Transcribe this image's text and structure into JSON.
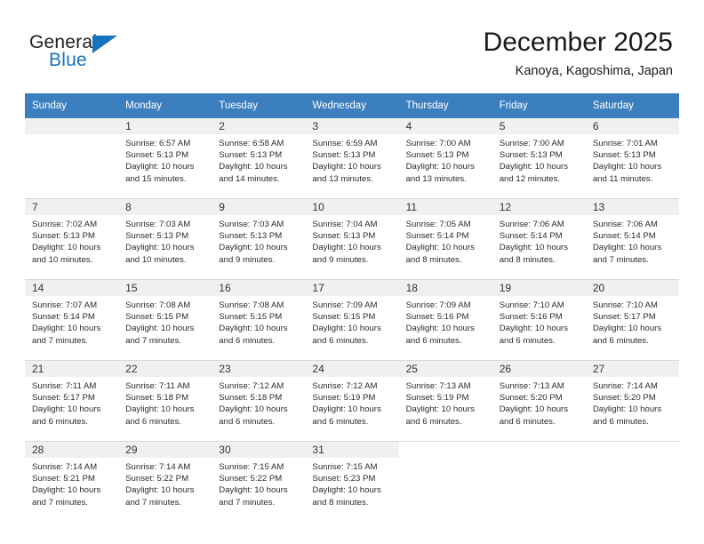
{
  "brand": {
    "name_part1": "General",
    "name_part2": "Blue",
    "accent_color": "#1673bd",
    "triangle_icon": "triangle-icon"
  },
  "header": {
    "title": "December 2025",
    "subtitle": "Kanoya, Kagoshima, Japan"
  },
  "theme": {
    "header_row_bg": "#3c7fbf",
    "daynum_band_bg": "#f0f0f0",
    "grid_line": "#d8d8d8"
  },
  "weekday_headers": [
    "Sunday",
    "Monday",
    "Tuesday",
    "Wednesday",
    "Thursday",
    "Friday",
    "Saturday"
  ],
  "labels": {
    "sunrise_prefix": "Sunrise:",
    "sunset_prefix": "Sunset:",
    "daylight_prefix": "Daylight:"
  },
  "weeks": [
    [
      {
        "day": "",
        "sunrise": "",
        "sunset": "",
        "daylight_line1": "",
        "daylight_line2": ""
      },
      {
        "day": "1",
        "sunrise": "Sunrise: 6:57 AM",
        "sunset": "Sunset: 5:13 PM",
        "daylight_line1": "Daylight: 10 hours",
        "daylight_line2": "and 15 minutes."
      },
      {
        "day": "2",
        "sunrise": "Sunrise: 6:58 AM",
        "sunset": "Sunset: 5:13 PM",
        "daylight_line1": "Daylight: 10 hours",
        "daylight_line2": "and 14 minutes."
      },
      {
        "day": "3",
        "sunrise": "Sunrise: 6:59 AM",
        "sunset": "Sunset: 5:13 PM",
        "daylight_line1": "Daylight: 10 hours",
        "daylight_line2": "and 13 minutes."
      },
      {
        "day": "4",
        "sunrise": "Sunrise: 7:00 AM",
        "sunset": "Sunset: 5:13 PM",
        "daylight_line1": "Daylight: 10 hours",
        "daylight_line2": "and 13 minutes."
      },
      {
        "day": "5",
        "sunrise": "Sunrise: 7:00 AM",
        "sunset": "Sunset: 5:13 PM",
        "daylight_line1": "Daylight: 10 hours",
        "daylight_line2": "and 12 minutes."
      },
      {
        "day": "6",
        "sunrise": "Sunrise: 7:01 AM",
        "sunset": "Sunset: 5:13 PM",
        "daylight_line1": "Daylight: 10 hours",
        "daylight_line2": "and 11 minutes."
      }
    ],
    [
      {
        "day": "7",
        "sunrise": "Sunrise: 7:02 AM",
        "sunset": "Sunset: 5:13 PM",
        "daylight_line1": "Daylight: 10 hours",
        "daylight_line2": "and 10 minutes."
      },
      {
        "day": "8",
        "sunrise": "Sunrise: 7:03 AM",
        "sunset": "Sunset: 5:13 PM",
        "daylight_line1": "Daylight: 10 hours",
        "daylight_line2": "and 10 minutes."
      },
      {
        "day": "9",
        "sunrise": "Sunrise: 7:03 AM",
        "sunset": "Sunset: 5:13 PM",
        "daylight_line1": "Daylight: 10 hours",
        "daylight_line2": "and 9 minutes."
      },
      {
        "day": "10",
        "sunrise": "Sunrise: 7:04 AM",
        "sunset": "Sunset: 5:13 PM",
        "daylight_line1": "Daylight: 10 hours",
        "daylight_line2": "and 9 minutes."
      },
      {
        "day": "11",
        "sunrise": "Sunrise: 7:05 AM",
        "sunset": "Sunset: 5:14 PM",
        "daylight_line1": "Daylight: 10 hours",
        "daylight_line2": "and 8 minutes."
      },
      {
        "day": "12",
        "sunrise": "Sunrise: 7:06 AM",
        "sunset": "Sunset: 5:14 PM",
        "daylight_line1": "Daylight: 10 hours",
        "daylight_line2": "and 8 minutes."
      },
      {
        "day": "13",
        "sunrise": "Sunrise: 7:06 AM",
        "sunset": "Sunset: 5:14 PM",
        "daylight_line1": "Daylight: 10 hours",
        "daylight_line2": "and 7 minutes."
      }
    ],
    [
      {
        "day": "14",
        "sunrise": "Sunrise: 7:07 AM",
        "sunset": "Sunset: 5:14 PM",
        "daylight_line1": "Daylight: 10 hours",
        "daylight_line2": "and 7 minutes."
      },
      {
        "day": "15",
        "sunrise": "Sunrise: 7:08 AM",
        "sunset": "Sunset: 5:15 PM",
        "daylight_line1": "Daylight: 10 hours",
        "daylight_line2": "and 7 minutes."
      },
      {
        "day": "16",
        "sunrise": "Sunrise: 7:08 AM",
        "sunset": "Sunset: 5:15 PM",
        "daylight_line1": "Daylight: 10 hours",
        "daylight_line2": "and 6 minutes."
      },
      {
        "day": "17",
        "sunrise": "Sunrise: 7:09 AM",
        "sunset": "Sunset: 5:15 PM",
        "daylight_line1": "Daylight: 10 hours",
        "daylight_line2": "and 6 minutes."
      },
      {
        "day": "18",
        "sunrise": "Sunrise: 7:09 AM",
        "sunset": "Sunset: 5:16 PM",
        "daylight_line1": "Daylight: 10 hours",
        "daylight_line2": "and 6 minutes."
      },
      {
        "day": "19",
        "sunrise": "Sunrise: 7:10 AM",
        "sunset": "Sunset: 5:16 PM",
        "daylight_line1": "Daylight: 10 hours",
        "daylight_line2": "and 6 minutes."
      },
      {
        "day": "20",
        "sunrise": "Sunrise: 7:10 AM",
        "sunset": "Sunset: 5:17 PM",
        "daylight_line1": "Daylight: 10 hours",
        "daylight_line2": "and 6 minutes."
      }
    ],
    [
      {
        "day": "21",
        "sunrise": "Sunrise: 7:11 AM",
        "sunset": "Sunset: 5:17 PM",
        "daylight_line1": "Daylight: 10 hours",
        "daylight_line2": "and 6 minutes."
      },
      {
        "day": "22",
        "sunrise": "Sunrise: 7:11 AM",
        "sunset": "Sunset: 5:18 PM",
        "daylight_line1": "Daylight: 10 hours",
        "daylight_line2": "and 6 minutes."
      },
      {
        "day": "23",
        "sunrise": "Sunrise: 7:12 AM",
        "sunset": "Sunset: 5:18 PM",
        "daylight_line1": "Daylight: 10 hours",
        "daylight_line2": "and 6 minutes."
      },
      {
        "day": "24",
        "sunrise": "Sunrise: 7:12 AM",
        "sunset": "Sunset: 5:19 PM",
        "daylight_line1": "Daylight: 10 hours",
        "daylight_line2": "and 6 minutes."
      },
      {
        "day": "25",
        "sunrise": "Sunrise: 7:13 AM",
        "sunset": "Sunset: 5:19 PM",
        "daylight_line1": "Daylight: 10 hours",
        "daylight_line2": "and 6 minutes."
      },
      {
        "day": "26",
        "sunrise": "Sunrise: 7:13 AM",
        "sunset": "Sunset: 5:20 PM",
        "daylight_line1": "Daylight: 10 hours",
        "daylight_line2": "and 6 minutes."
      },
      {
        "day": "27",
        "sunrise": "Sunrise: 7:14 AM",
        "sunset": "Sunset: 5:20 PM",
        "daylight_line1": "Daylight: 10 hours",
        "daylight_line2": "and 6 minutes."
      }
    ],
    [
      {
        "day": "28",
        "sunrise": "Sunrise: 7:14 AM",
        "sunset": "Sunset: 5:21 PM",
        "daylight_line1": "Daylight: 10 hours",
        "daylight_line2": "and 7 minutes."
      },
      {
        "day": "29",
        "sunrise": "Sunrise: 7:14 AM",
        "sunset": "Sunset: 5:22 PM",
        "daylight_line1": "Daylight: 10 hours",
        "daylight_line2": "and 7 minutes."
      },
      {
        "day": "30",
        "sunrise": "Sunrise: 7:15 AM",
        "sunset": "Sunset: 5:22 PM",
        "daylight_line1": "Daylight: 10 hours",
        "daylight_line2": "and 7 minutes."
      },
      {
        "day": "31",
        "sunrise": "Sunrise: 7:15 AM",
        "sunset": "Sunset: 5:23 PM",
        "daylight_line1": "Daylight: 10 hours",
        "daylight_line2": "and 8 minutes."
      },
      {
        "day": "",
        "sunrise": "",
        "sunset": "",
        "daylight_line1": "",
        "daylight_line2": ""
      },
      {
        "day": "",
        "sunrise": "",
        "sunset": "",
        "daylight_line1": "",
        "daylight_line2": ""
      },
      {
        "day": "",
        "sunrise": "",
        "sunset": "",
        "daylight_line1": "",
        "daylight_line2": ""
      }
    ]
  ]
}
